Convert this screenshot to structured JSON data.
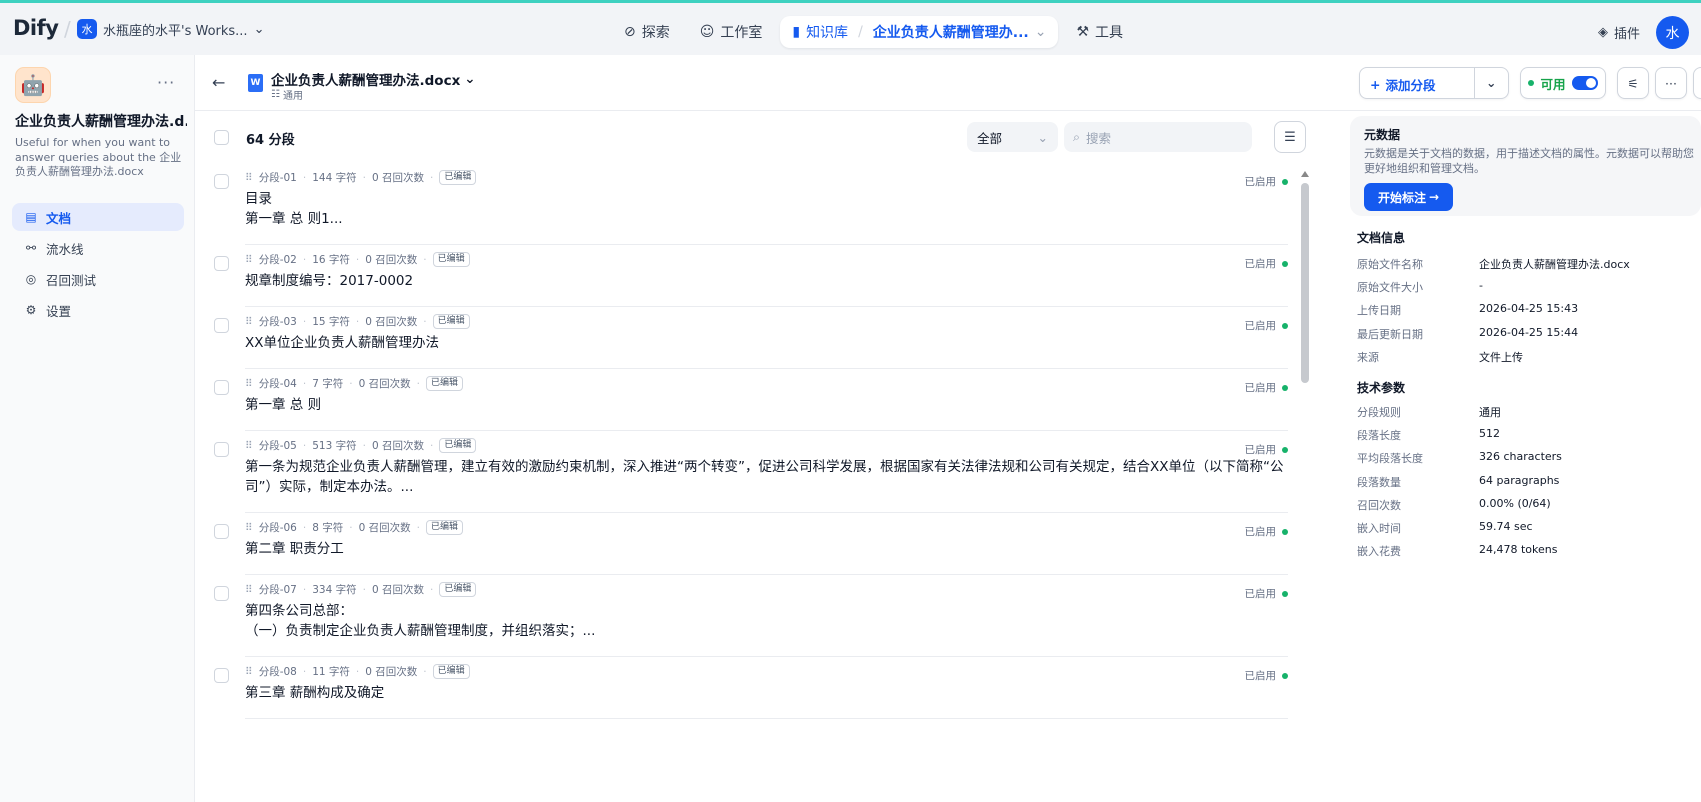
{
  "nav": {
    "logo": "Dify",
    "workspace_avatar": "水",
    "workspace_name": "水瓶座的水平's Works...",
    "explore": "探索",
    "studio": "工作室",
    "knowledge": "知识库",
    "knowledge_crumb": "企业负责人薪酬管理办...",
    "tools": "工具",
    "plugins": "插件",
    "user_avatar": "水"
  },
  "sidebar": {
    "kb_name": "企业负责人薪酬管理办法.d...",
    "kb_desc": "Useful for when you want to answer queries about the 企业负责人薪酬管理办法.docx",
    "items": [
      {
        "label": "文档",
        "icon": "document-icon"
      },
      {
        "label": "流水线",
        "icon": "pipeline-icon"
      },
      {
        "label": "召回测试",
        "icon": "target-icon"
      },
      {
        "label": "设置",
        "icon": "settings-icon"
      }
    ]
  },
  "header": {
    "title": "企业负责人薪酬管理办法.docx",
    "sub": "通用",
    "add_segment": "添加分段",
    "available": "可用"
  },
  "list": {
    "count": "64 分段",
    "filter": "全部",
    "search_placeholder": "搜索"
  },
  "segments": [
    {
      "id": "分段-01",
      "chars": "144 字符",
      "hits": "0 召回次数",
      "badge": "已编辑",
      "status": "已启用",
      "text": "目录\n第一章 总 则1..."
    },
    {
      "id": "分段-02",
      "chars": "16 字符",
      "hits": "0 召回次数",
      "badge": "已编辑",
      "status": "已启用",
      "text": "规章制度编号：2017-0002"
    },
    {
      "id": "分段-03",
      "chars": "15 字符",
      "hits": "0 召回次数",
      "badge": "已编辑",
      "status": "已启用",
      "text": "XX单位企业负责人薪酬管理办法"
    },
    {
      "id": "分段-04",
      "chars": "7 字符",
      "hits": "0 召回次数",
      "badge": "已编辑",
      "status": "已启用",
      "text": "第一章 总 则"
    },
    {
      "id": "分段-05",
      "chars": "513 字符",
      "hits": "0 召回次数",
      "badge": "已编辑",
      "status": "已启用",
      "text": "第一条为规范企业负责人薪酬管理，建立有效的激励约束机制，深入推进“两个转变”，促进公司科学发展，根据国家有关法律法规和公司有关规定，结合XX单位（以下简称“公司”）实际，制定本办法。..."
    },
    {
      "id": "分段-06",
      "chars": "8 字符",
      "hits": "0 召回次数",
      "badge": "已编辑",
      "status": "已启用",
      "text": "第二章 职责分工"
    },
    {
      "id": "分段-07",
      "chars": "334 字符",
      "hits": "0 召回次数",
      "badge": "已编辑",
      "status": "已启用",
      "text": "第四条公司总部：\n（一）负责制定企业负责人薪酬管理制度，并组织落实；..."
    },
    {
      "id": "分段-08",
      "chars": "11 字符",
      "hits": "0 召回次数",
      "badge": "已编辑",
      "status": "已启用",
      "text": "第三章 薪酬构成及确定"
    }
  ],
  "panel": {
    "meta_title": "元数据",
    "meta_desc": "元数据是关于文档的数据，用于描述文档的属性。元数据可以帮助您更好地组织和管理文档。",
    "start_label": "开始标注",
    "doc_info_title": "文档信息",
    "doc_info": [
      {
        "k": "原始文件名称",
        "v": "企业负责人薪酬管理办法.docx"
      },
      {
        "k": "原始文件大小",
        "v": "-"
      },
      {
        "k": "上传日期",
        "v": "2026-04-25 15:43"
      },
      {
        "k": "最后更新日期",
        "v": "2026-04-25 15:44"
      },
      {
        "k": "来源",
        "v": "文件上传"
      }
    ],
    "tech_title": "技术参数",
    "tech": [
      {
        "k": "分段规则",
        "v": "通用"
      },
      {
        "k": "段落长度",
        "v": "512"
      },
      {
        "k": "平均段落长度",
        "v": "326 characters"
      },
      {
        "k": "段落数量",
        "v": "64 paragraphs"
      },
      {
        "k": "召回次数",
        "v": "0.00% (0/64)"
      },
      {
        "k": "嵌入时间",
        "v": "59.74 sec"
      },
      {
        "k": "嵌入花费",
        "v": "24,478 tokens"
      }
    ]
  },
  "colors": {
    "accent": "#155aef",
    "enabled": "#17b26a"
  }
}
